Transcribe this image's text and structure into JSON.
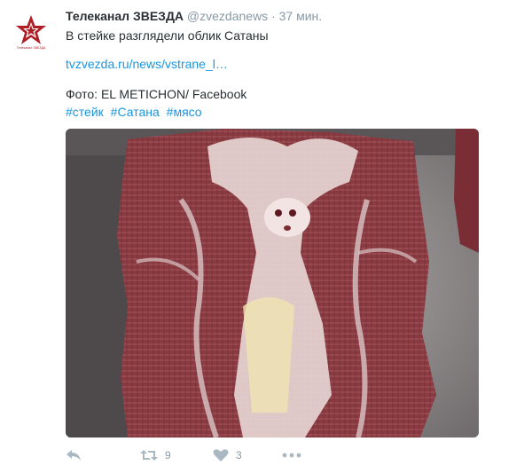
{
  "tweet": {
    "author_name": "Телеканал ЗВЕЗДА",
    "handle": "@zvezdanews",
    "separator": "·",
    "time": "37 мин.",
    "text": "В стейке разглядели облик Сатаны",
    "link": "tvzvezda.ru/news/vstrane_l…",
    "credit": "Фото: EL METICHON/ Facebook",
    "hashtags": [
      "#стейк",
      "#Сатана",
      "#мясо"
    ],
    "retweets": "9",
    "likes": "3",
    "avatar_text": "Телеканал ЗВЕЗДА"
  },
  "colors": {
    "brand_red": "#b01e25",
    "link_blue": "#1b95e0",
    "meta_gray": "#8899a6"
  },
  "icons": [
    "zvezda-logo-icon",
    "reply-icon",
    "retweet-icon",
    "like-icon",
    "more-icon"
  ]
}
